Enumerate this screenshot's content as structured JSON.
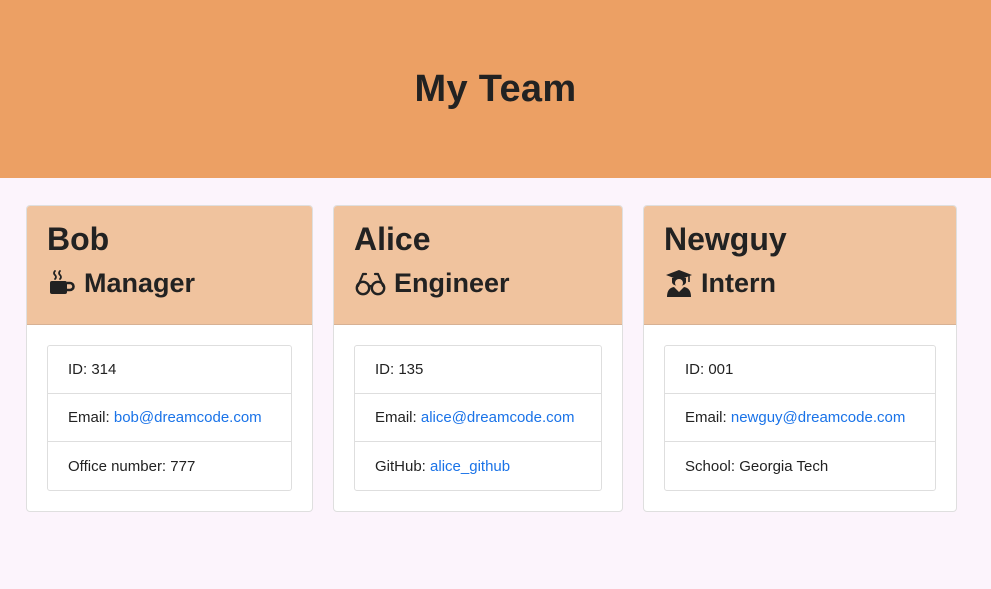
{
  "header": {
    "title": "My Team"
  },
  "team": [
    {
      "name": "Bob",
      "role": "Manager",
      "icon": "coffee-icon",
      "id_label": "ID:",
      "id_value": "314",
      "email_label": "Email:",
      "email": "bob@dreamcode.com",
      "extra_label": "Office number:",
      "extra_value": "777"
    },
    {
      "name": "Alice",
      "role": "Engineer",
      "icon": "glasses-icon",
      "id_label": "ID:",
      "id_value": "135",
      "email_label": "Email:",
      "email": "alice@dreamcode.com",
      "extra_label": "GitHub:",
      "extra_value": "alice_github"
    },
    {
      "name": "Newguy",
      "role": "Intern",
      "icon": "graduate-icon",
      "id_label": "ID:",
      "id_value": "001",
      "email_label": "Email:",
      "email": "newguy@dreamcode.com",
      "extra_label": "School:",
      "extra_value": "Georgia Tech"
    }
  ],
  "colors": {
    "header_bg": "#eca064",
    "card_header_bg": "#f0c39e",
    "page_bg": "#fcf4fc",
    "link": "#1a73e8"
  }
}
